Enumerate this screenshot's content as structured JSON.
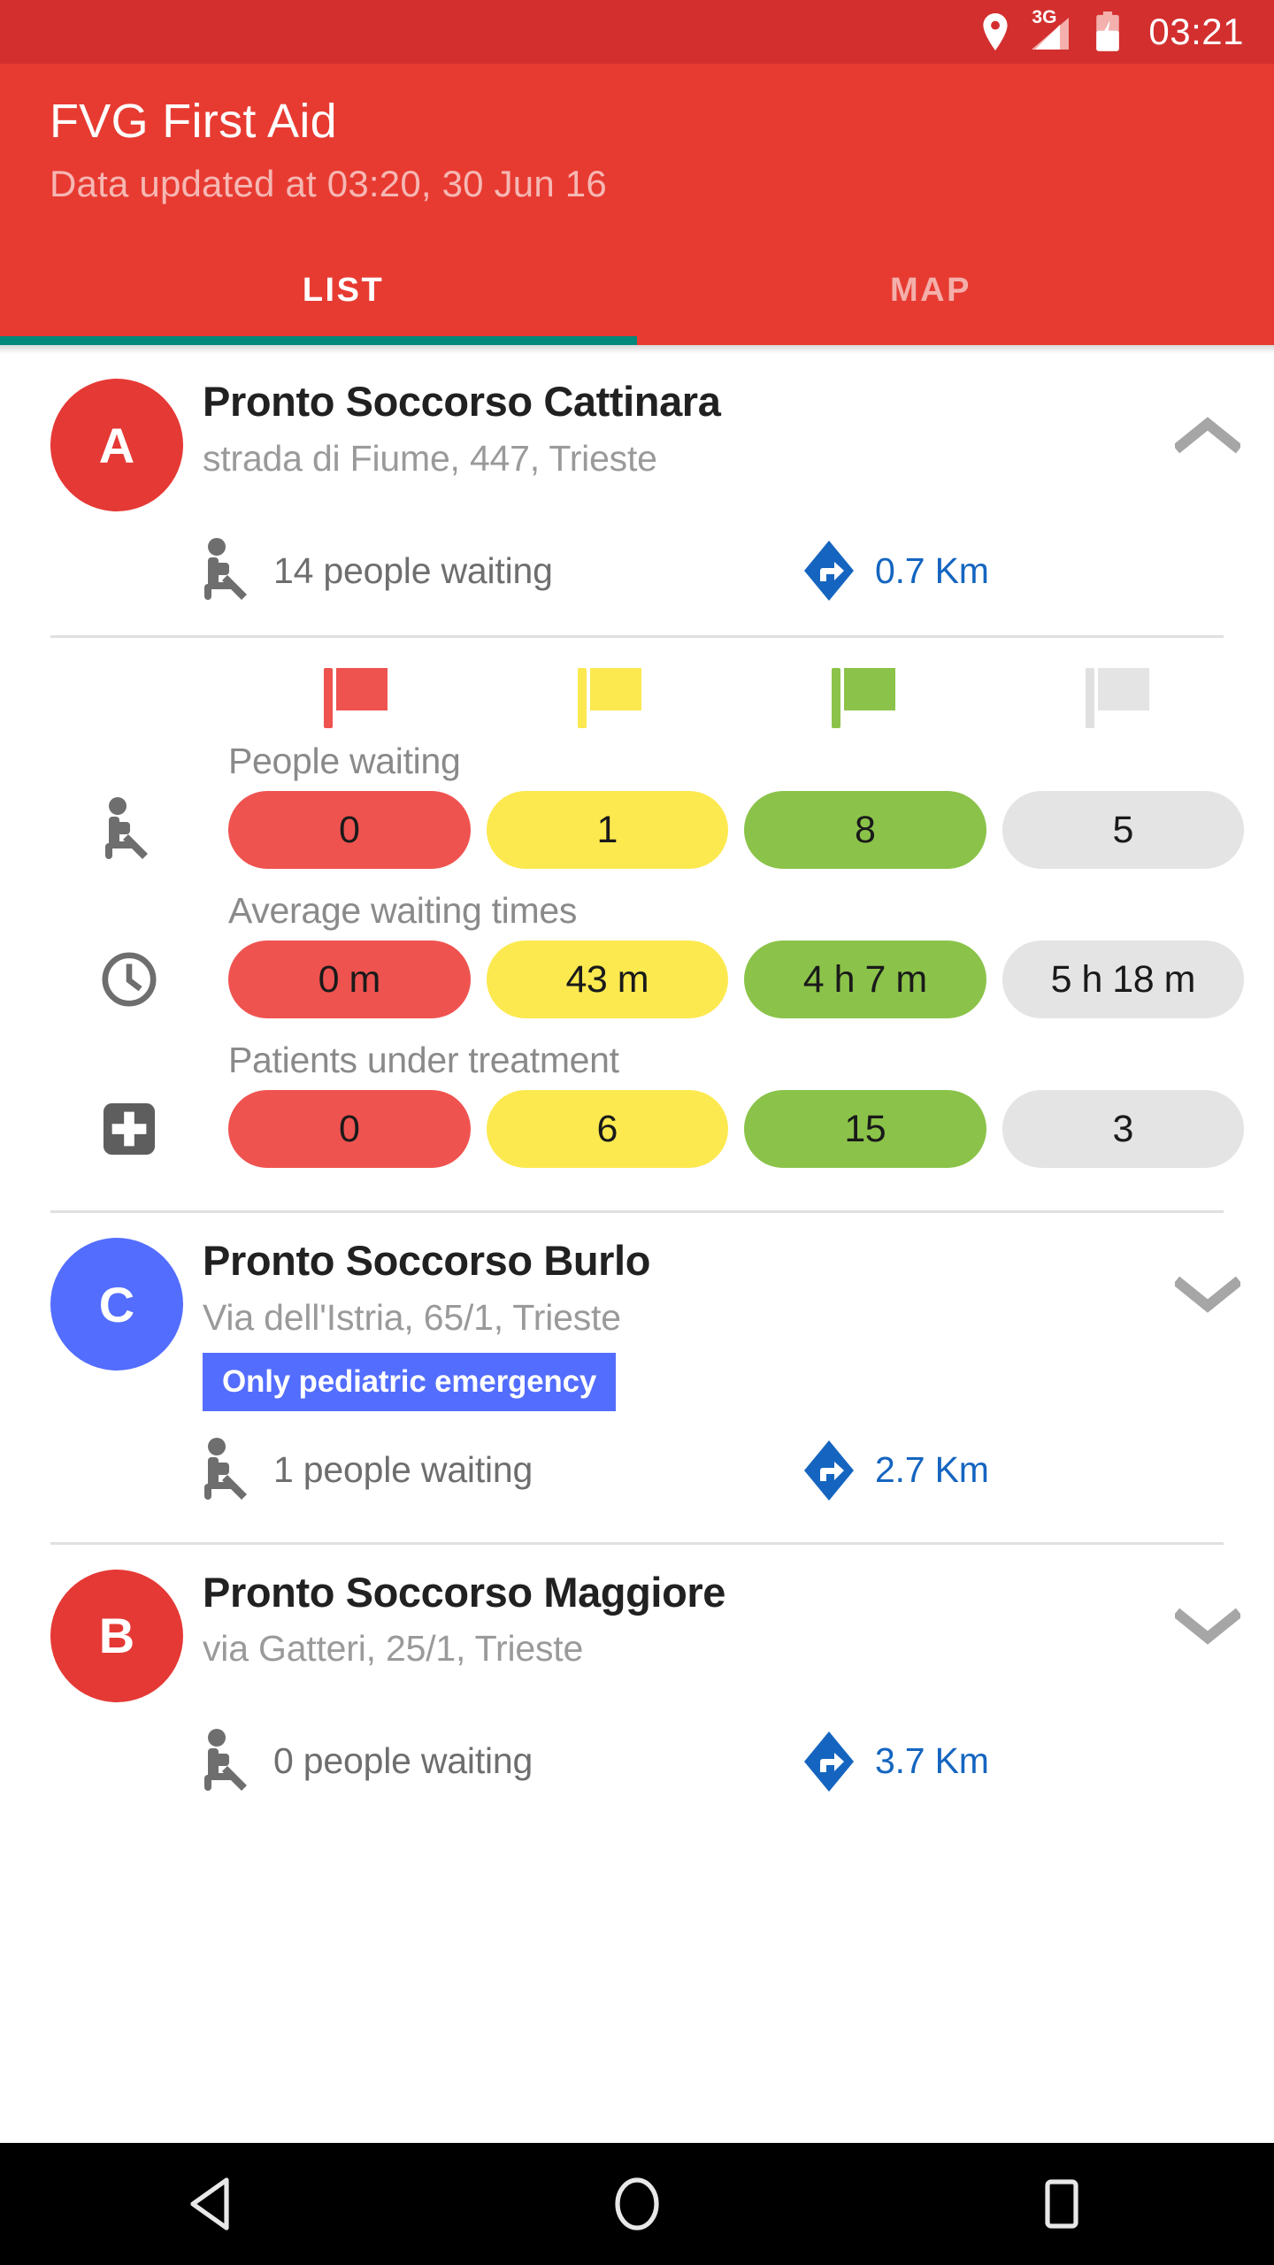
{
  "status_bar": {
    "location_icon": "location-pin-icon",
    "network_label": "3G",
    "signal_icon": "signal-bars-icon",
    "battery_icon": "battery-charging-icon",
    "time": "03:21"
  },
  "app_bar": {
    "title": "FVG First Aid",
    "subtitle": "Data updated at 03:20, 30 Jun 16",
    "tabs": [
      {
        "label": "LIST",
        "active": true
      },
      {
        "label": "MAP",
        "active": false
      }
    ]
  },
  "colors": {
    "primary": "#E73B32",
    "status_bar": "#D32F2F",
    "tab_indicator": "#00897B",
    "avatar_red": "#E53935",
    "avatar_blue": "#536DFE",
    "badge_blue": "#536DFE",
    "distance_blue": "#1565C0",
    "flag_red": "#EF5350",
    "flag_yellow": "#FCE94F",
    "flag_green": "#8BC34A",
    "flag_white": "#E4E4E4"
  },
  "hospitals": [
    {
      "marker": "A",
      "marker_color": "#E53935",
      "name": "Pronto Soccorso Cattinara",
      "address": "strada di Fiume, 447, Trieste",
      "badge": null,
      "waiting_text": "14 people waiting",
      "distance_text": "0.7 Km",
      "expanded": true,
      "chevron": "chevron-up-icon",
      "detail": {
        "flags": [
          "red",
          "yellow",
          "green",
          "white"
        ],
        "rows": [
          {
            "label": "People waiting",
            "icon": "seated-person-icon",
            "values": [
              "0",
              "1",
              "8",
              "5"
            ]
          },
          {
            "label": "Average waiting times",
            "icon": "clock-icon",
            "values": [
              "0 m",
              "43 m",
              "4 h 7 m",
              "5 h 18 m"
            ]
          },
          {
            "label": "Patients under treatment",
            "icon": "medical-cross-icon",
            "values": [
              "0",
              "6",
              "15",
              "3"
            ]
          }
        ]
      }
    },
    {
      "marker": "C",
      "marker_color": "#536DFE",
      "name": "Pronto Soccorso Burlo",
      "address": "Via dell'Istria, 65/1, Trieste",
      "badge": "Only pediatric emergency",
      "waiting_text": "1 people waiting",
      "distance_text": "2.7 Km",
      "expanded": false,
      "chevron": "chevron-down-icon",
      "detail": null
    },
    {
      "marker": "B",
      "marker_color": "#E53935",
      "name": "Pronto Soccorso Maggiore",
      "address": "via Gatteri, 25/1, Trieste",
      "badge": null,
      "waiting_text": "0 people waiting",
      "distance_text": "3.7 Km",
      "expanded": false,
      "chevron": "chevron-down-icon",
      "detail": null
    }
  ],
  "nav_bar": {
    "back": "back-triangle-icon",
    "home": "home-circle-icon",
    "recents": "recents-square-icon"
  }
}
